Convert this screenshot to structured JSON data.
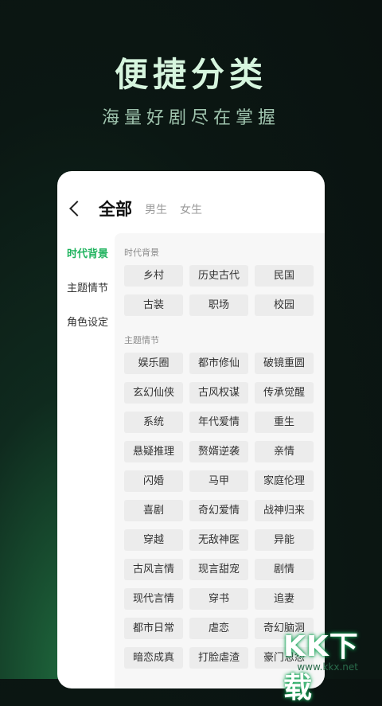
{
  "hero": {
    "title": "便捷分类",
    "subtitle": "海量好剧尽在掌握"
  },
  "header": {
    "tab_all": "全部",
    "tab_male": "男生",
    "tab_female": "女生"
  },
  "sidebar": {
    "items": [
      {
        "label": "时代背景",
        "active": true
      },
      {
        "label": "主题情节",
        "active": false
      },
      {
        "label": "角色设定",
        "active": false
      }
    ]
  },
  "content": {
    "section1_title": "时代背景",
    "section1_items": [
      "乡村",
      "历史古代",
      "民国",
      "古装",
      "职场",
      "校园"
    ],
    "section2_title": "主题情节",
    "section2_items": [
      "娱乐圈",
      "都市修仙",
      "破镜重圆",
      "玄幻仙侠",
      "古风权谋",
      "传承觉醒",
      "系统",
      "年代爱情",
      "重生",
      "悬疑推理",
      "赘婿逆袭",
      "亲情",
      "闪婚",
      "马甲",
      "家庭伦理",
      "喜剧",
      "奇幻爱情",
      "战神归来",
      "穿越",
      "无敌神医",
      "异能",
      "古风言情",
      "现言甜宠",
      "剧情",
      "现代言情",
      "穿书",
      "追妻",
      "都市日常",
      "虐恋",
      "奇幻脑洞",
      "暗恋成真",
      "打脸虐渣",
      "豪门恩怨"
    ]
  },
  "watermark": {
    "logo": "KK下载",
    "url": "www.kkx.net"
  }
}
